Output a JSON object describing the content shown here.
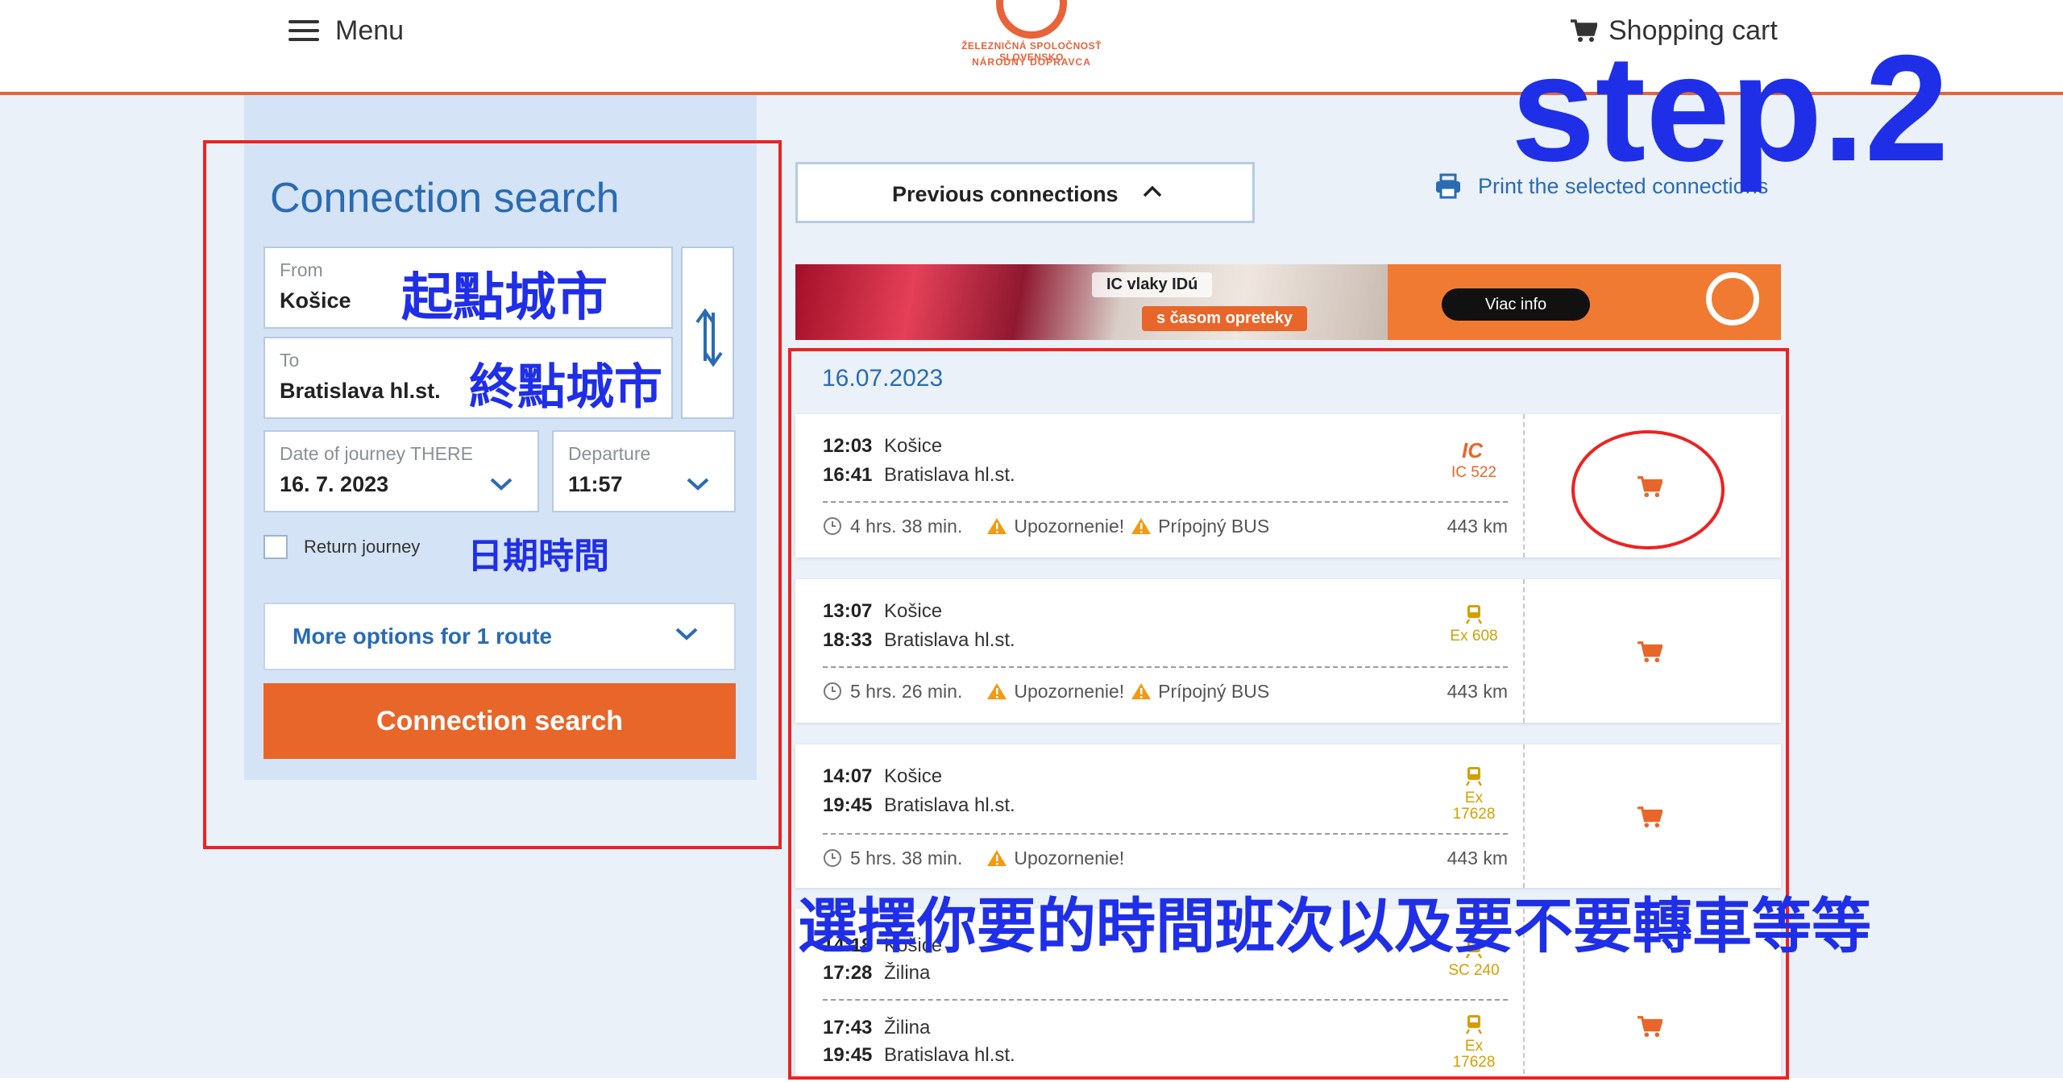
{
  "header": {
    "menu_label": "Menu",
    "cart_label": "Shopping cart",
    "logo_line1": "ŽELEZNIČNÁ SPOLOČNOSŤ SLOVENSKO",
    "logo_line2": "NÁRODNÝ DOPRAVCA"
  },
  "search": {
    "title": "Connection search",
    "from_label": "From",
    "from_value": "Košice",
    "to_label": "To",
    "to_value": "Bratislava hl.st.",
    "date_label": "Date of journey THERE",
    "date_value": "16. 7. 2023",
    "departure_label": "Departure",
    "departure_value": "11:57",
    "return_label": "Return journey",
    "more_options_label": "More options for 1 route",
    "search_button_label": "Connection search"
  },
  "results": {
    "previous_label": "Previous connections",
    "print_label": "Print the selected connections",
    "banner_text1": "IC vlaky IDú",
    "banner_text2": "s časom opreteky",
    "banner_button": "Viac info",
    "date": "16.07.2023",
    "connections": [
      {
        "dep_time": "12:03",
        "dep_station": "Košice",
        "arr_time": "16:41",
        "arr_station": "Bratislava hl.st.",
        "train": "IC 522",
        "duration": "4 hrs. 38 min.",
        "warning": "Upozornenie!",
        "warning2": "Prípojný BUS",
        "distance": "443 km"
      },
      {
        "dep_time": "13:07",
        "dep_station": "Košice",
        "arr_time": "18:33",
        "arr_station": "Bratislava hl.st.",
        "train": "Ex 608",
        "duration": "5 hrs. 26 min.",
        "warning": "Upozornenie!",
        "warning2": "Prípojný BUS",
        "distance": "443 km"
      },
      {
        "dep_time": "14:07",
        "dep_station": "Košice",
        "arr_time": "19:45",
        "arr_station": "Bratislava hl.st.",
        "train_type": "Ex",
        "train_number": "17628",
        "duration": "5 hrs. 38 min.",
        "warning": "Upozornenie!",
        "distance": "443 km"
      }
    ],
    "transfer_connection": {
      "leg1_dep_time": "14:18",
      "leg1_dep_station": "Košice",
      "leg1_arr_time": "17:28",
      "leg1_arr_station": "Žilina",
      "leg1_train": "SC 240",
      "leg2_dep_time": "17:43",
      "leg2_dep_station": "Žilina",
      "leg2_arr_time": "19:45",
      "leg2_arr_station": "Bratislava hl.st.",
      "leg2_train_type": "Ex",
      "leg2_train_number": "17628"
    }
  },
  "annotations": {
    "step": "step.2",
    "from_note": "起點城市",
    "to_note": "終點城市",
    "date_note": "日期時間",
    "select_note": "選擇你要的時間班次以及要不要轉車等等"
  },
  "colors": {
    "accent": "#e8662a",
    "link_blue": "#2a6bb3",
    "panel_bg": "#d4e3f5",
    "annotation_blue": "#1f2fe8",
    "annotation_red": "#ee2222"
  }
}
